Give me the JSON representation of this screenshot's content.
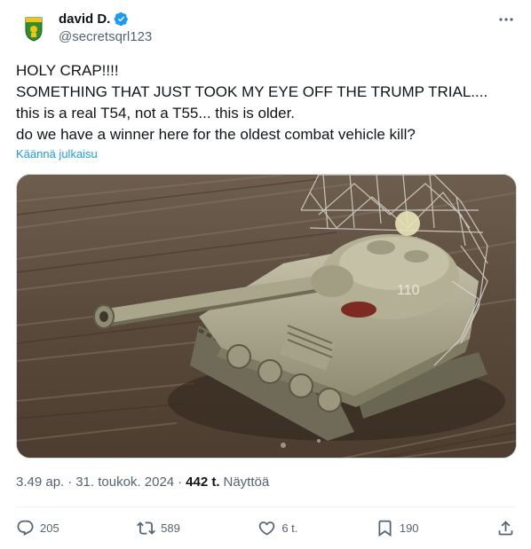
{
  "author": {
    "display_name": "david D.",
    "handle": "@secretsqrl123",
    "verified": true,
    "verified_color": "#1d9bf0"
  },
  "tweet": {
    "lines": [
      "HOLY CRAP!!!!",
      "SOMETHING THAT JUST TOOK MY EYE OFF THE TRUMP TRIAL....",
      "this is a real T54, not a T55... this is older.",
      "do we have a winner here for the oldest combat vehicle kill?"
    ],
    "translate_label": "Käännä julkaisu",
    "media": {
      "turret_number": "110"
    }
  },
  "meta": {
    "time": "3.49 ap.",
    "separator": "·",
    "date": "31. toukok. 2024",
    "separator2": "·",
    "views_count": "442 t.",
    "views_label": "Näyttöä"
  },
  "actions": {
    "replies": "205",
    "reposts": "589",
    "likes": "6 t.",
    "bookmarks": "190"
  },
  "icons": {
    "more": "more-icon",
    "reply": "reply-icon",
    "repost": "repost-icon",
    "like": "heart-icon",
    "bookmark": "bookmark-icon",
    "share": "share-icon"
  },
  "colors": {
    "text": "#0f1419",
    "secondary": "#536471",
    "link": "#1d9bf0"
  }
}
